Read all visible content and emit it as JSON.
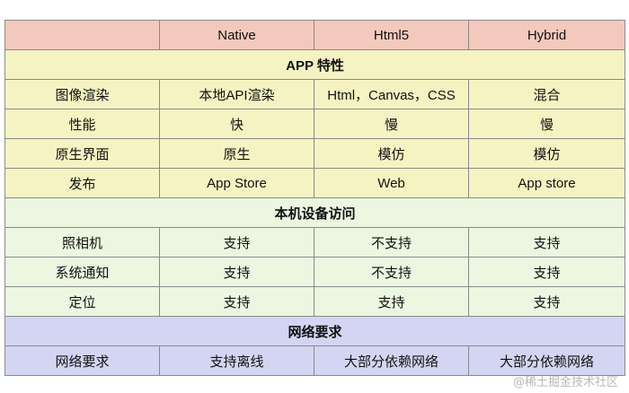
{
  "colors": {
    "header_bg": "#f4c9bd",
    "section_app_bg": "#f6f3c3",
    "section_device_bg": "#ecf7e2",
    "section_network_bg": "#d4d5f2",
    "border": "#8a8a8a"
  },
  "table": {
    "header": [
      "",
      "Native",
      "Html5",
      "Hybrid"
    ],
    "sections": [
      {
        "id": "app",
        "title": "APP 特性",
        "rows": [
          [
            "图像渲染",
            "本地API渲染",
            "Html，Canvas，CSS",
            "混合"
          ],
          [
            "性能",
            "快",
            "慢",
            "慢"
          ],
          [
            "原生界面",
            "原生",
            "模仿",
            "模仿"
          ],
          [
            "发布",
            "App Store",
            "Web",
            "App store"
          ]
        ]
      },
      {
        "id": "device",
        "title": "本机设备访问",
        "rows": [
          [
            "照相机",
            "支持",
            "不支持",
            "支持"
          ],
          [
            "系统通知",
            "支持",
            "不支持",
            "支持"
          ],
          [
            "定位",
            "支持",
            "支持",
            "支持"
          ]
        ]
      },
      {
        "id": "network",
        "title": "网络要求",
        "rows": [
          [
            "网络要求",
            "支持离线",
            "大部分依赖网络",
            "大部分依赖网络"
          ]
        ]
      }
    ]
  },
  "watermark": "@稀土掘金技术社区"
}
